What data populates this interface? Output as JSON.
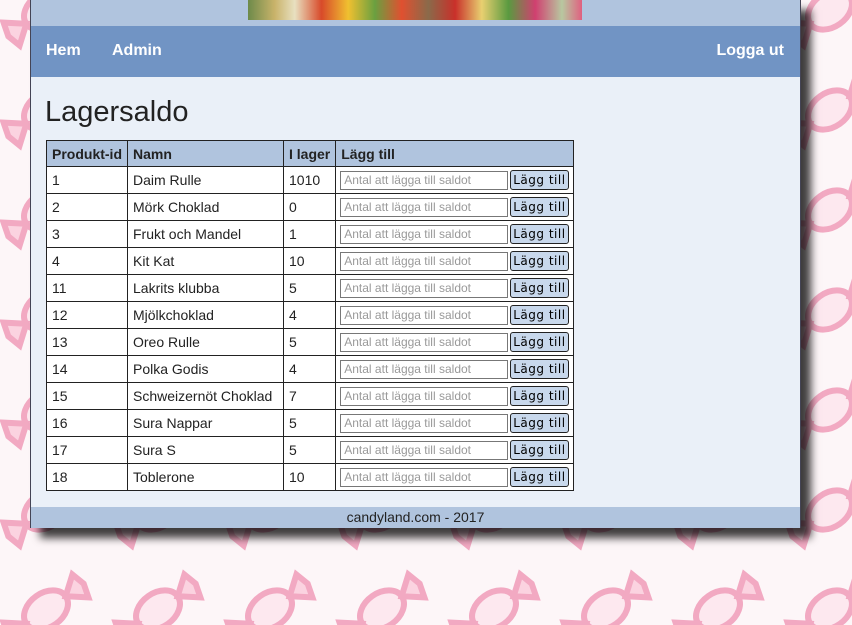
{
  "nav": {
    "home": "Hem",
    "admin": "Admin",
    "logout": "Logga ut"
  },
  "page": {
    "title": "Lagersaldo"
  },
  "table": {
    "columns": [
      "Produkt-id",
      "Namn",
      "I lager",
      "Lägg till"
    ],
    "placeholder": "Antal att lägga till saldot",
    "button_label": "Lägg till",
    "rows": [
      {
        "id": "1",
        "name": "Daim Rulle",
        "stock": "1010"
      },
      {
        "id": "2",
        "name": "Mörk Choklad",
        "stock": "0"
      },
      {
        "id": "3",
        "name": "Frukt och Mandel",
        "stock": "1"
      },
      {
        "id": "4",
        "name": "Kit Kat",
        "stock": "10"
      },
      {
        "id": "11",
        "name": "Lakrits klubba",
        "stock": "5"
      },
      {
        "id": "12",
        "name": "Mjölkchoklad",
        "stock": "4"
      },
      {
        "id": "13",
        "name": "Oreo Rulle",
        "stock": "5"
      },
      {
        "id": "14",
        "name": "Polka Godis",
        "stock": "4"
      },
      {
        "id": "15",
        "name": "Schweizernöt Choklad",
        "stock": "7"
      },
      {
        "id": "16",
        "name": "Sura Nappar",
        "stock": "5"
      },
      {
        "id": "17",
        "name": "Sura S",
        "stock": "5"
      },
      {
        "id": "18",
        "name": "Toblerone",
        "stock": "10"
      }
    ]
  },
  "footer": {
    "text": "candyland.com - 2017"
  },
  "colors": {
    "nav": "#7194c4",
    "header_strip": "#b0c4de",
    "content": "#eaf0f8",
    "wallpaper_candy": "#f4b8cc"
  },
  "icons": {
    "background": "candy-wrapper-pattern"
  }
}
